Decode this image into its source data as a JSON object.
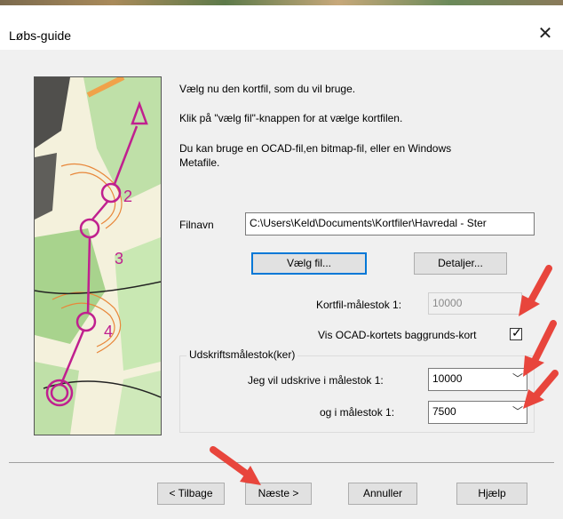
{
  "window": {
    "title": "Løbs-guide",
    "close_icon": "close-icon"
  },
  "intro": {
    "line1": "Vælg nu den kortfil, som du vil bruge.",
    "line2": "Klik på \"vælg fil\"-knappen for at vælge kortfilen.",
    "line3a": "Du kan bruge en OCAD-fil,en bitmap-fil, eller en Windows",
    "line3b": "Metafile."
  },
  "file": {
    "label": "Filnavn",
    "value": "C:\\Users\\Keld\\Documents\\Kortfiler\\Havredal - Ster"
  },
  "buttons": {
    "choose_file": "Vælg fil...",
    "details": "Detaljer...",
    "back": "< Tilbage",
    "next": "Næste >",
    "cancel": "Annuller",
    "help": "Hjælp"
  },
  "map_scale": {
    "label": "Kortfil-målestok  1:",
    "value": "10000"
  },
  "background": {
    "label": "Vis OCAD-kortets baggrunds-kort",
    "checked": true
  },
  "print_scales": {
    "group_label": "Udskriftsmålestok(ker)",
    "scale1_label": "Jeg vil udskrive i målestok  1:",
    "scale1_value": "10000",
    "scale2_label": "og i målestok  1:",
    "scale2_value": "7500"
  },
  "colors": {
    "accent": "#0078d7",
    "annotation_arrow": "#e8453c",
    "course_magenta": "#c0208f"
  }
}
